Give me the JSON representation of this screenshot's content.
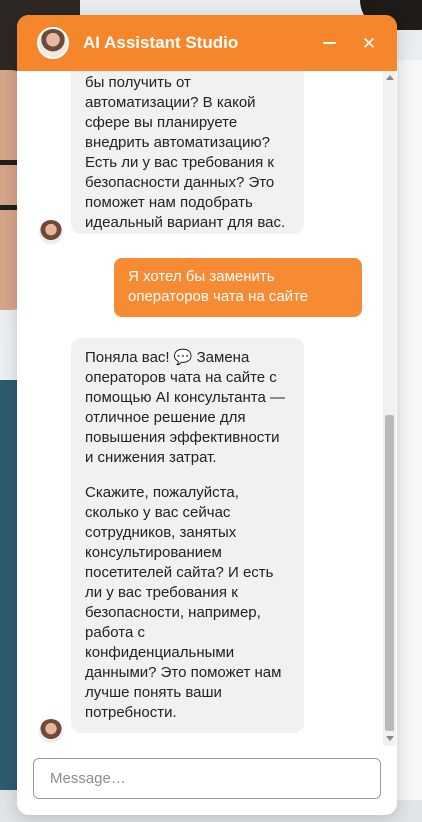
{
  "header": {
    "title": "AI Assistant Studio",
    "avatar": "assistant-avatar",
    "minimize_icon": "minimize-icon",
    "close_icon": "close-icon",
    "close_glyph": "✕",
    "background_color": "#f5862b"
  },
  "messages": {
    "bot_1": {
      "lines": [
        "бы получить от",
        "автоматизации? В какой",
        "сфере вы планируете",
        "внедрить автоматизацию?",
        "Есть ли у вас требования к",
        "безопасности данных? Это",
        "поможет нам подобрать",
        "идеальный вариант для вас."
      ]
    },
    "user_1": {
      "lines": [
        "Я хотел бы заменить",
        "операторов чата на сайте"
      ]
    },
    "bot_2": {
      "paragraph_1": [
        "Поняла вас! 💬 Замена",
        "операторов чата на сайте с",
        "помощью AI консультанта —",
        "отличное решение для",
        "повышения эффективности",
        "и снижения затрат."
      ],
      "paragraph_2": [
        "Скажите, пожалуйста,",
        "сколько у вас сейчас",
        "сотрудников, занятых",
        "консультированием",
        "посетителей сайта? И есть",
        "ли у вас требования к",
        "безопасности, например,",
        "работа с",
        "конфиденциальными",
        "данными? Это поможет нам",
        "лучше понять ваши",
        "потребности."
      ]
    }
  },
  "input": {
    "placeholder": "Message…",
    "value": ""
  },
  "colors": {
    "accent": "#f5862b",
    "user_bubble": "#f68b33",
    "bot_bubble": "#f1f1f1"
  }
}
